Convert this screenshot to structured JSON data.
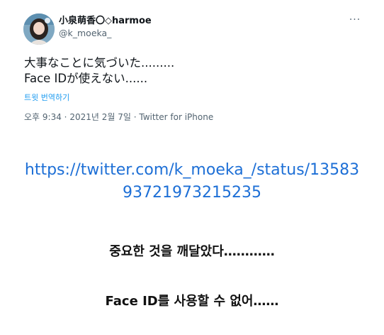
{
  "tweet": {
    "display_name": "小泉萌香〇◇harmoe",
    "handle": "@k_moeka_",
    "text": "大事なことに気づいた.........\nFace IDが使えない......",
    "translate_label": "트윗 번역하기",
    "time": "오후 9:34",
    "date": "2021년 2월 7일",
    "source": "Twitter for iPhone",
    "more_icon": "more-horizontal-icon"
  },
  "url": "https://twitter.com/k_moeka_/status/1358393721973215235",
  "translations": {
    "line1": "중요한 것을 깨달았다…………",
    "line2": "Face ID를 사용할 수 없어……"
  },
  "colors": {
    "link": "#1d6fd6",
    "translate_link": "#1d9bf0",
    "muted": "#536471"
  }
}
